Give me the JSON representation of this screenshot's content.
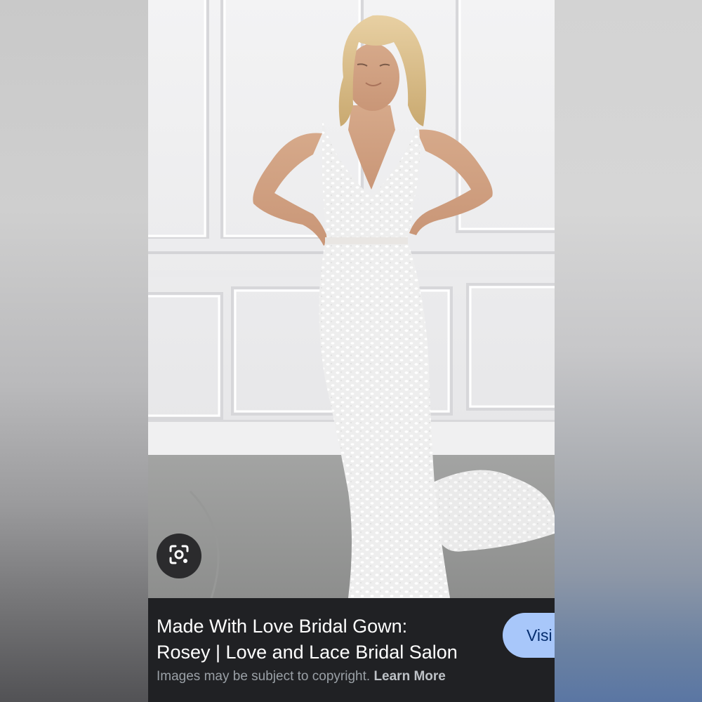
{
  "result": {
    "title_line1": "Made With Love Bridal Gown:",
    "title_line2": "Rosey | Love and Lace Bridal Salon",
    "copyright_notice": "Images may be subject to copyright.",
    "learn_more_label": "Learn More",
    "visit_label": "Visi"
  },
  "icons": {
    "lens": "google-lens-icon"
  },
  "colors": {
    "caption_background": "#202124",
    "visit_button": "#a8c7fa",
    "visit_text": "#062e6f",
    "muted_text": "#9aa0a6"
  }
}
